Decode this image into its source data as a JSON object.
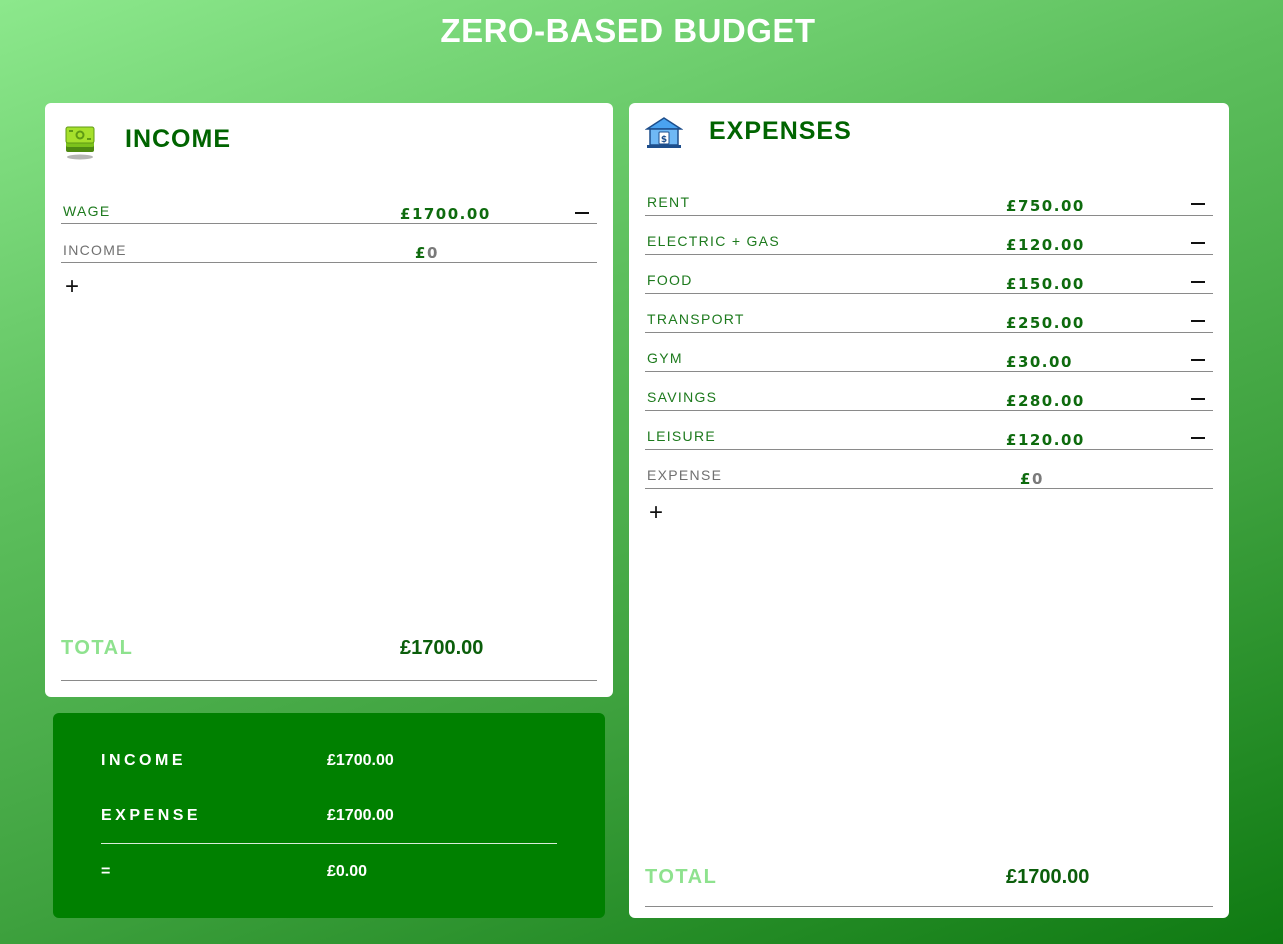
{
  "page": {
    "title": "ZERO-BASED BUDGET"
  },
  "income": {
    "title": "INCOME",
    "icon": "money-stack-icon",
    "items": [
      {
        "label": "WAGE",
        "currency": "£",
        "amount": "1700.00"
      }
    ],
    "new_item": {
      "label_placeholder": "INCOME",
      "currency": "£",
      "amount_placeholder": "0"
    },
    "add_symbol": "+",
    "total_label": "TOTAL",
    "total_value": "£1700.00"
  },
  "expenses": {
    "title": "EXPENSES",
    "icon": "bank-icon",
    "items": [
      {
        "label": "RENT",
        "currency": "£",
        "amount": "750.00"
      },
      {
        "label": "ELECTRIC + GAS",
        "currency": "£",
        "amount": "120.00"
      },
      {
        "label": "FOOD",
        "currency": "£",
        "amount": "150.00"
      },
      {
        "label": "TRANSPORT",
        "currency": "£",
        "amount": "250.00"
      },
      {
        "label": "GYM",
        "currency": "£",
        "amount": "30.00"
      },
      {
        "label": "SAVINGS",
        "currency": "£",
        "amount": "280.00"
      },
      {
        "label": "LEISURE",
        "currency": "£",
        "amount": "120.00"
      }
    ],
    "new_item": {
      "label_placeholder": "EXPENSE",
      "currency": "£",
      "amount_placeholder": "0"
    },
    "add_symbol": "+",
    "total_label": "TOTAL",
    "total_value": "£1700.00"
  },
  "summary": {
    "income_label": "INCOME",
    "income_value": "£1700.00",
    "expense_label": "EXPENSE",
    "expense_value": "£1700.00",
    "result_label": "=",
    "result_value": "£0.00"
  },
  "colors": {
    "primary_green": "#006400",
    "summary_bg": "#008000",
    "total_label_green": "#8ee28e"
  }
}
